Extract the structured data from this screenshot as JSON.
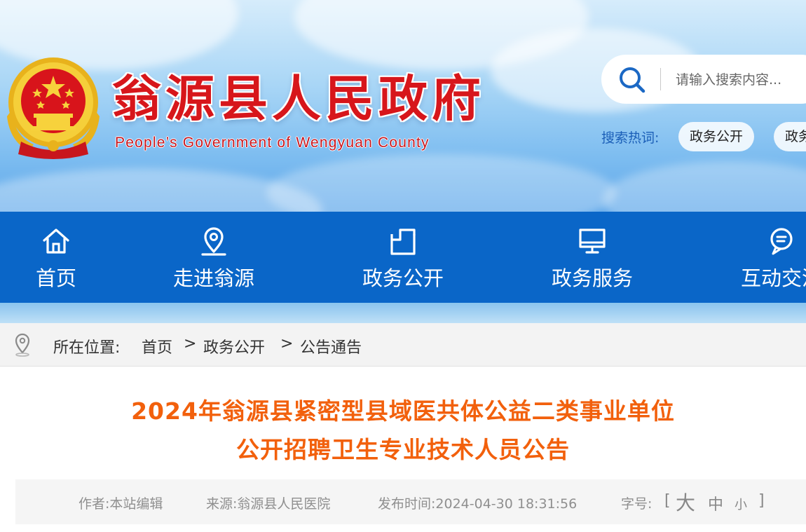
{
  "header": {
    "site_title": "翁源县人民政府",
    "site_subtitle": "People’s Government of Wengyuan County",
    "search": {
      "placeholder": "请输入搜索内容..."
    },
    "hot_search": {
      "label": "搜索热词:",
      "tags": [
        "政务公开",
        "政务"
      ]
    }
  },
  "nav": {
    "items": [
      {
        "label": "首页",
        "icon": "home-icon"
      },
      {
        "label": "走进翁源",
        "icon": "location-pin-icon"
      },
      {
        "label": "政务公开",
        "icon": "folder-icon"
      },
      {
        "label": "政务服务",
        "icon": "monitor-icon"
      },
      {
        "label": "互动交流",
        "icon": "chat-bubble-icon"
      }
    ]
  },
  "breadcrumb": {
    "prefix": "所在位置:",
    "items": [
      "首页",
      "政务公开",
      "公告通告"
    ],
    "separator": ">"
  },
  "article": {
    "title_line1": "2024年翁源县紧密型县域医共体公益二类事业单位",
    "title_line2": "公开招聘卫生专业技术人员公告",
    "meta": {
      "author": "作者:本站编辑",
      "source": "来源:翁源县人民医院",
      "published": "发布时间:2024-04-30 18:31:56",
      "font_size_label": "字号:",
      "bracket_open": "[",
      "font_large": "大",
      "font_medium": "中",
      "font_small": "小",
      "bracket_close": "]"
    }
  },
  "colors": {
    "nav_blue": "#0a66c8",
    "title_red": "#d7161b",
    "article_title_orange": "#f2600c",
    "hot_label_blue": "#1b5fb8"
  }
}
